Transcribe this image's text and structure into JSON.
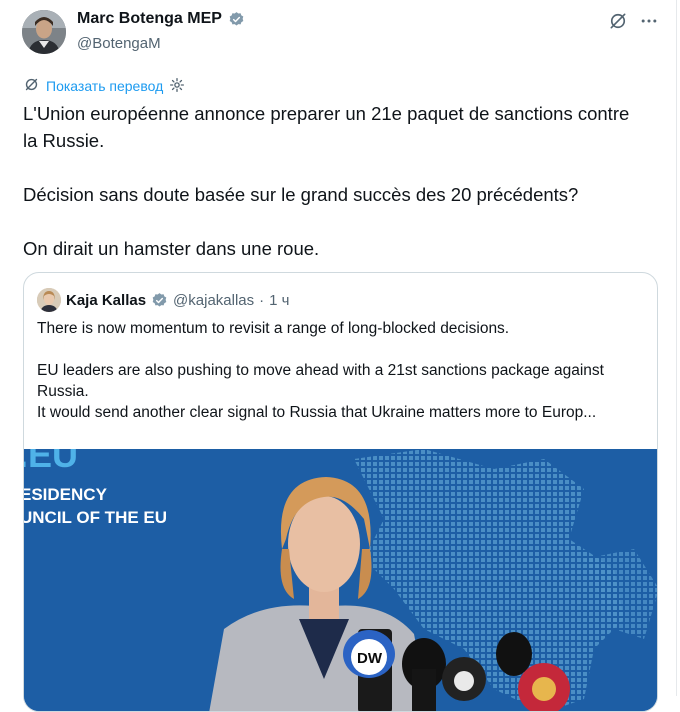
{
  "tweet": {
    "author_name": "Marc Botenga MEP",
    "handle": "@BotengaM",
    "translate_label": "Показать перевод",
    "text_lines": [
      "L'Union européenne annonce preparer un 21e paquet de sanctions contre",
      "la Russie.",
      "",
      "Décision sans doute basée sur le grand succès des 20 précédents?",
      "",
      "On dirait un hamster dans une roue."
    ]
  },
  "quote": {
    "author_name": "Kaja Kallas",
    "handle": "@kajakallas",
    "separator": "·",
    "time": "1 ч",
    "text_lines": [
      "There is now momentum to revisit a range of long-blocked decisions.",
      "",
      "EU leaders are also pushing to move ahead with a 21st sanctions package against",
      "Russia.",
      "It would send another clear signal to Russia that Ukraine matters more to Europ..."
    ],
    "image": {
      "banner_lines": [
        ".EU",
        "ESIDENCY",
        "UNCIL OF THE EU"
      ],
      "mic_logo": "DW"
    }
  },
  "colors": {
    "accent": "#1d9bf0",
    "verified": "#829aab",
    "image_bg": "#1b5fa8"
  },
  "icons": [
    "avatar",
    "verified-badge-icon",
    "grok-icon",
    "more-icon",
    "translate-icon",
    "settings-gear-icon"
  ]
}
